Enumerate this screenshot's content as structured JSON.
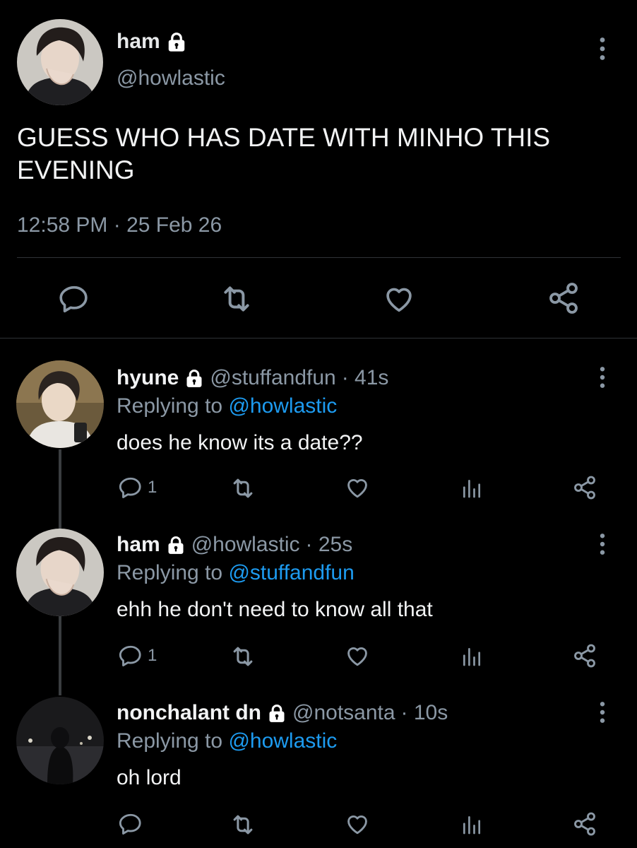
{
  "main_tweet": {
    "name": "ham",
    "handle": "@howlastic",
    "text": "GUESS WHO HAS DATE WITH MINHO THIS EVENING",
    "timestamp": "12:58 PM · 25 Feb 26",
    "avatar_icon": "avatar-photo",
    "actions": [
      "reply-icon",
      "retweet-icon",
      "like-icon",
      "share-icon"
    ]
  },
  "replies": [
    {
      "name": "hyune",
      "handle": "@stuffandfun",
      "time": "· 41s",
      "replying_prefix": "Replying to",
      "replying_to": "@howlastic",
      "text": "does he know its a date??",
      "reply_count": "1"
    },
    {
      "name": "ham",
      "handle": "@howlastic",
      "time": "· 25s",
      "replying_prefix": "Replying to",
      "replying_to": "@stuffandfun",
      "text": "ehh he don't need to know all that",
      "reply_count": "1"
    },
    {
      "name": "nonchalant dn",
      "handle": "@notsanta",
      "time": "· 10s",
      "replying_prefix": "Replying to",
      "replying_to": "@howlastic",
      "text": "oh lord",
      "reply_count": ""
    }
  ],
  "colors": {
    "background": "#000000",
    "text": "#e7e9ea",
    "muted": "#8b98a5",
    "link": "#1d9bf0",
    "divider": "#2f3336"
  }
}
